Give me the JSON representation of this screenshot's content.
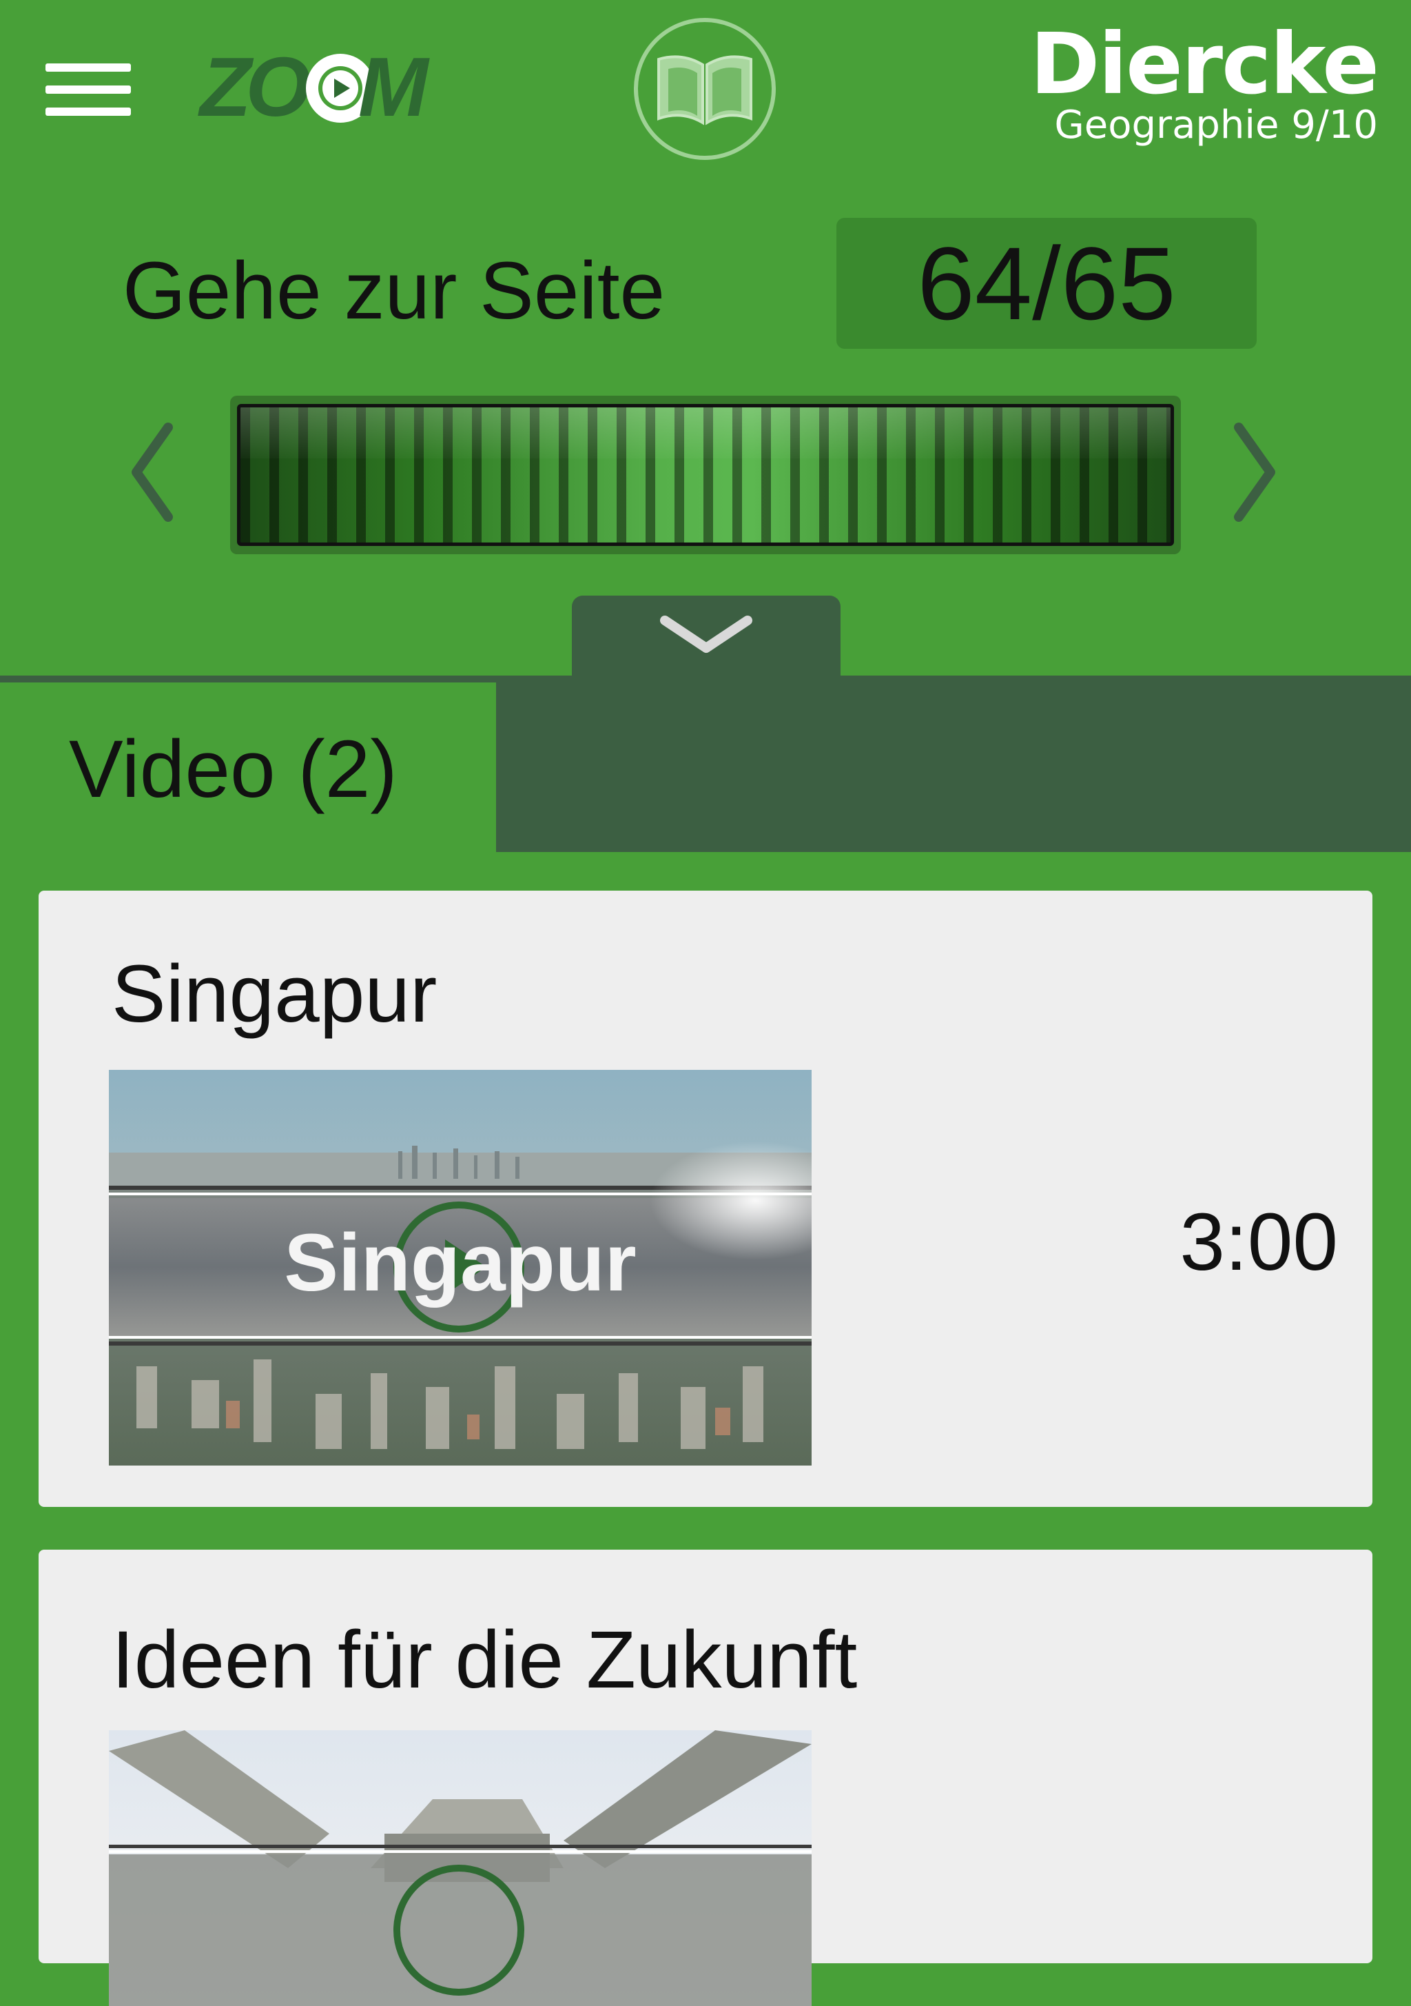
{
  "header": {
    "menu_icon": "hamburger-menu-icon",
    "logo_left": "ZOOM",
    "logo_left_letters_start": "ZO",
    "logo_left_letters_end": "M",
    "book_icon": "book-icon",
    "brand_name": "Diercke",
    "brand_subtitle": "Geographie 9/10"
  },
  "navigation": {
    "goto_label": "Gehe zur Seite",
    "page_value": "64/65",
    "prev_icon": "chevron-left-icon",
    "next_icon": "chevron-right-icon",
    "collapse_icon": "chevron-down-icon"
  },
  "tabs": {
    "active_label": "Video (2)"
  },
  "videos": [
    {
      "title": "Singapur",
      "thumbnail_caption": "Singapur",
      "duration": "3:00"
    },
    {
      "title": "Ideen für die Zukunft",
      "duration": ""
    }
  ],
  "colors": {
    "primary_green": "#48a038",
    "dark_green": "#3c5f42",
    "card_bg": "#eeeeee"
  }
}
